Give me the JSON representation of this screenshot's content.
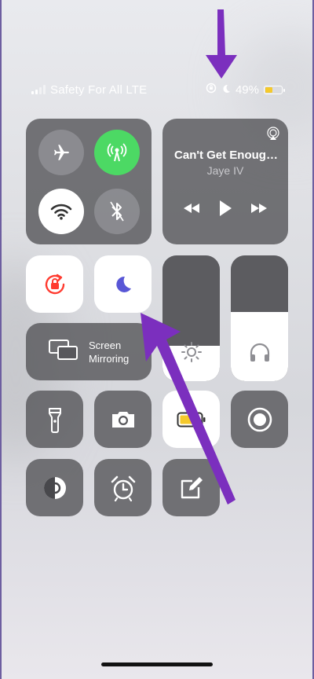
{
  "status_bar": {
    "carrier": "Safety For All LTE",
    "battery_percent": "49%",
    "battery_level": 0.49,
    "icons": [
      "orientation-lock-icon",
      "moon-icon"
    ]
  },
  "connectivity": {
    "airplane": {
      "icon": "airplane-icon",
      "on": false
    },
    "cellular": {
      "icon": "antenna-icon",
      "on": true,
      "color": "#4cd964"
    },
    "wifi": {
      "icon": "wifi-icon",
      "on": true
    },
    "bluetooth": {
      "icon": "bluetooth-icon",
      "on": false
    }
  },
  "media": {
    "song": "Can't Get Enoug…",
    "artist": "Jaye IV"
  },
  "screen_mirroring": {
    "line1": "Screen",
    "line2": "Mirroring"
  },
  "controls": {
    "orientation_lock": {
      "icon": "rotation-lock-icon",
      "on": true,
      "color": "#ff3b30"
    },
    "do_not_disturb": {
      "icon": "moon-icon",
      "on": true,
      "color": "#5856d6"
    },
    "brightness_level": 0.28,
    "volume_level": 0.55,
    "row3": [
      "flashlight-icon",
      "camera-icon",
      "battery-icon",
      "record-icon"
    ],
    "row4": [
      "color-filter-icon",
      "alarm-icon",
      "notes-icon"
    ]
  },
  "annotation_color": "#7b2fbe"
}
